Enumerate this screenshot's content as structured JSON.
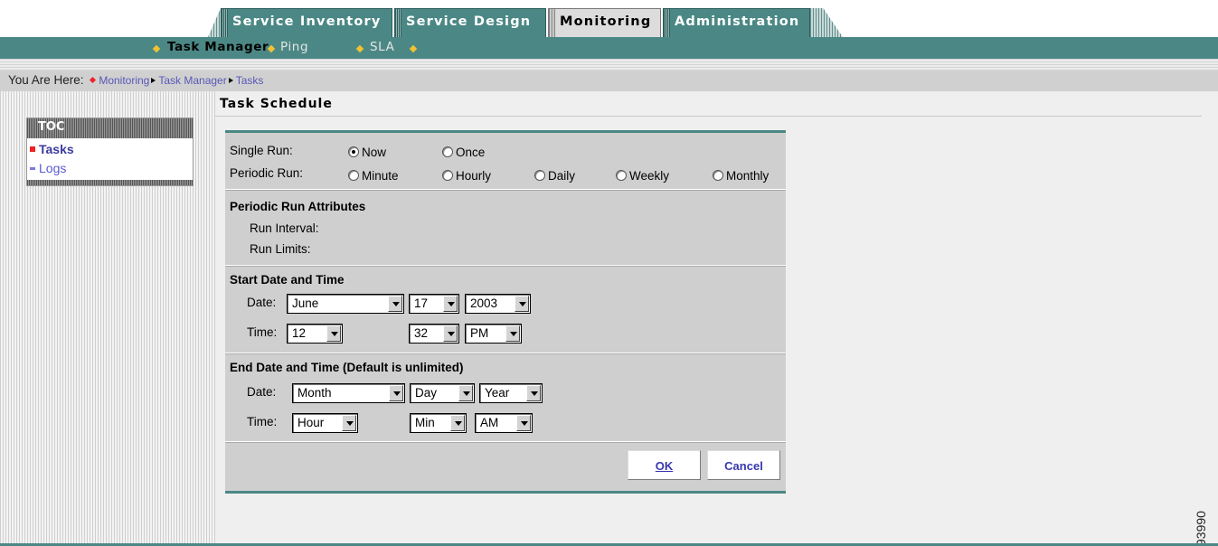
{
  "tabs": [
    {
      "label": "Service Inventory",
      "active": false
    },
    {
      "label": "Service Design",
      "active": false
    },
    {
      "label": "Monitoring",
      "active": true
    },
    {
      "label": "Administration",
      "active": false
    }
  ],
  "subnav": {
    "items": [
      {
        "label": "Task Manager",
        "active": true
      },
      {
        "label": "Ping",
        "active": false
      },
      {
        "label": "SLA",
        "active": false
      }
    ]
  },
  "breadcrumb": {
    "lead": "You Are Here:",
    "crumbs": [
      "Monitoring",
      "Task Manager",
      "Tasks"
    ]
  },
  "toc": {
    "title": "TOC",
    "items": [
      {
        "label": "Tasks",
        "active": true
      },
      {
        "label": "Logs",
        "active": false
      }
    ]
  },
  "page": {
    "title": "Task Schedule"
  },
  "schedule": {
    "single_run": {
      "label": "Single Run:",
      "options": [
        {
          "label": "Now",
          "checked": true
        },
        {
          "label": "Once",
          "checked": false
        }
      ]
    },
    "periodic_run": {
      "label": "Periodic Run:",
      "options": [
        {
          "label": "Minute",
          "checked": false
        },
        {
          "label": "Hourly",
          "checked": false
        },
        {
          "label": "Daily",
          "checked": false
        },
        {
          "label": "Weekly",
          "checked": false
        },
        {
          "label": "Monthly",
          "checked": false
        }
      ]
    },
    "attributes": {
      "heading": "Periodic Run Attributes",
      "run_interval_label": "Run Interval:",
      "run_limits_label": "Run Limits:"
    },
    "start": {
      "heading": "Start Date and Time",
      "date_label": "Date:",
      "time_label": "Time:",
      "month": "June",
      "day": "17",
      "year": "2003",
      "hour": "12",
      "minute": "32",
      "ampm": "PM"
    },
    "end": {
      "heading": "End Date and Time (Default is unlimited)",
      "date_label": "Date:",
      "time_label": "Time:",
      "month": "Month",
      "day": "Day",
      "year": "Year",
      "hour": "Hour",
      "minute": "Min",
      "ampm": "AM"
    },
    "buttons": {
      "ok": "OK",
      "cancel": "Cancel"
    }
  },
  "figure_id": "93990",
  "colors": {
    "teal": "#4b8885",
    "link": "#3838b0",
    "panel": "#cfcfcf",
    "accent_diamond": "#f1c232"
  }
}
